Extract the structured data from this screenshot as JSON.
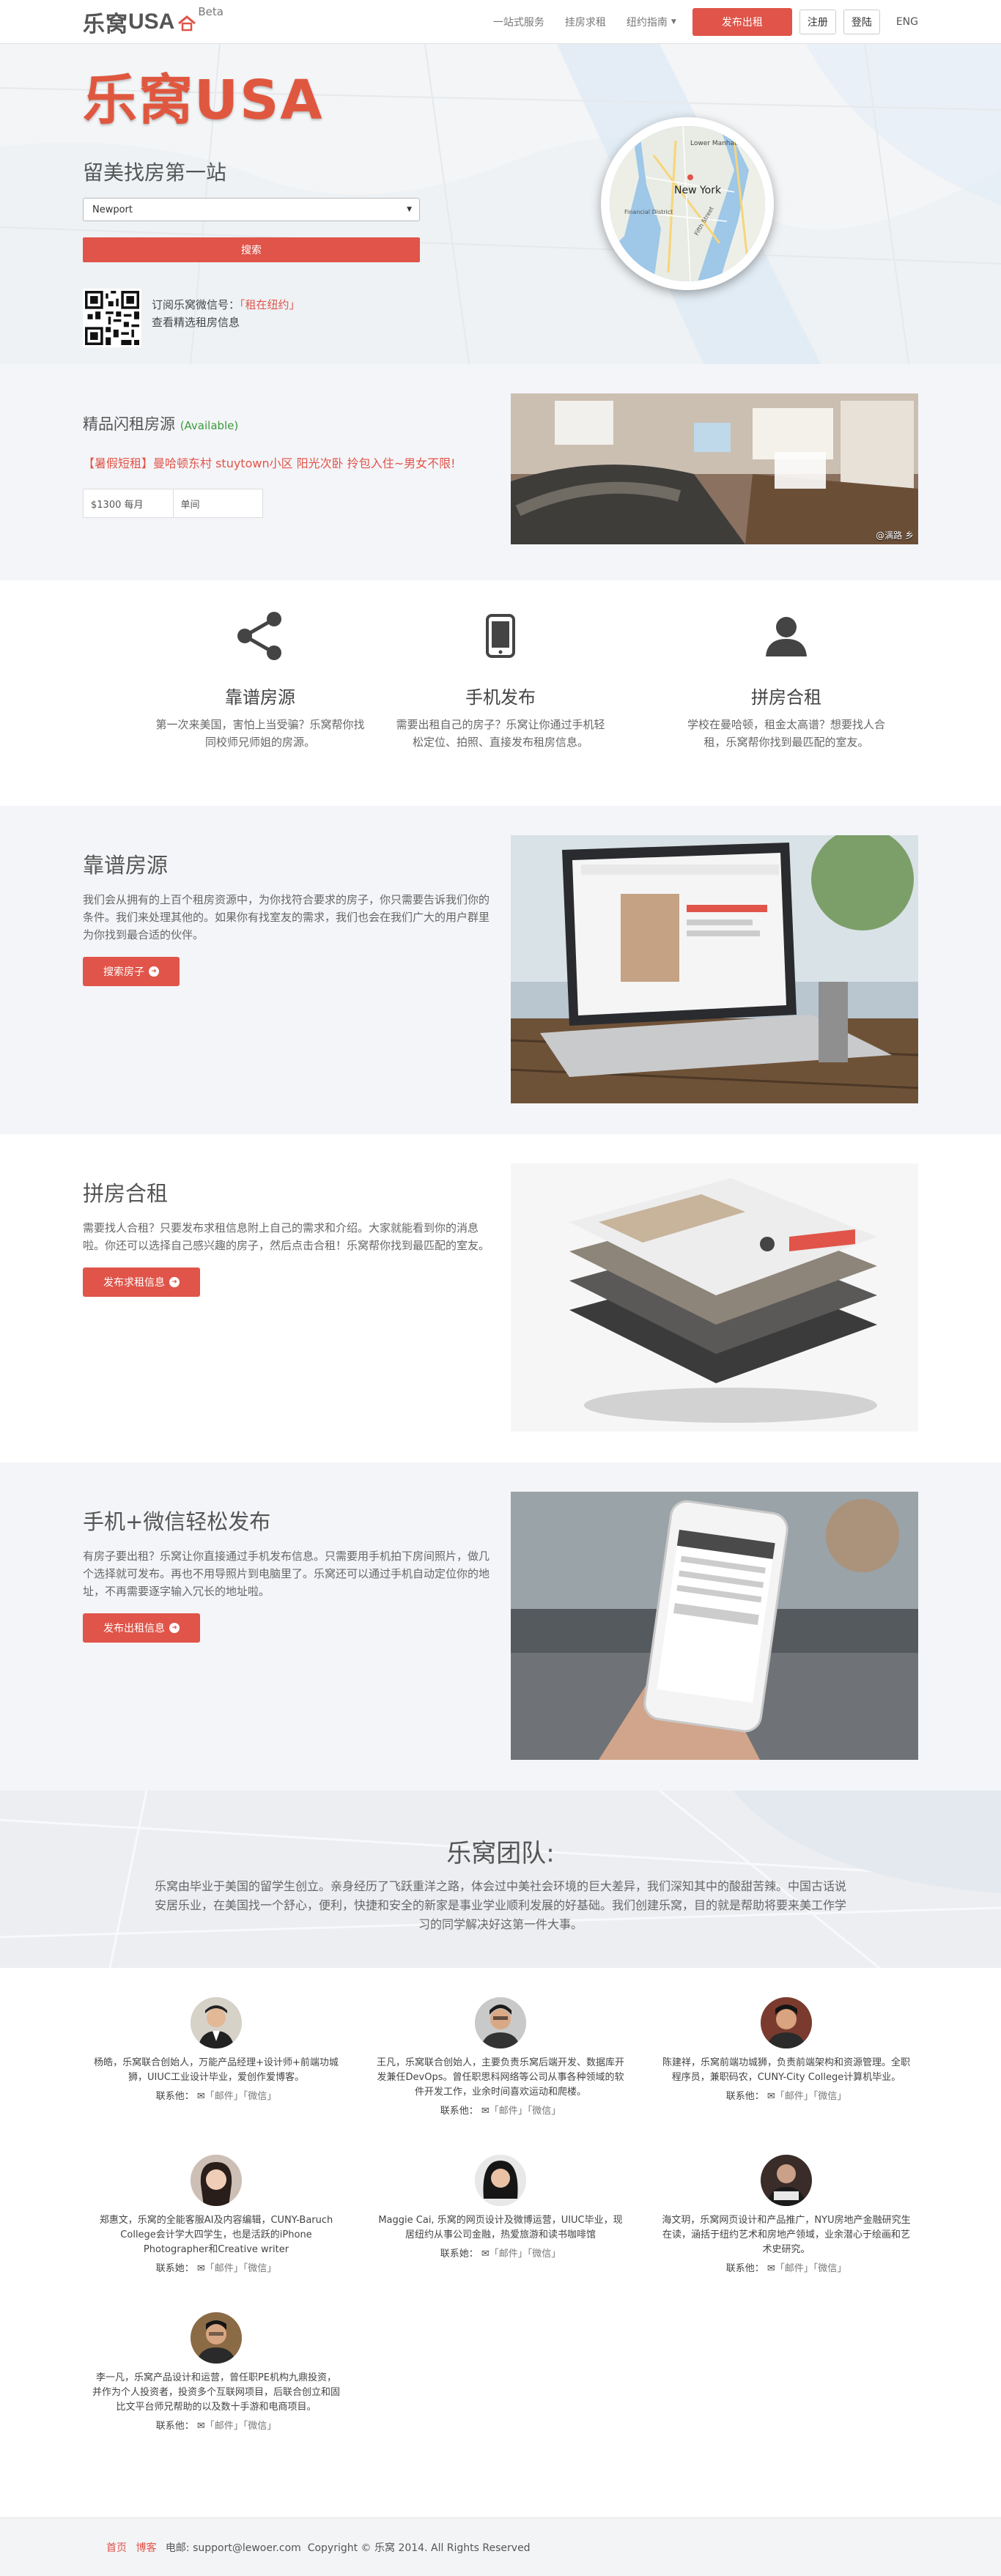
{
  "nav": {
    "logo_cn": "乐窝",
    "logo_en": "USA",
    "beta": "Beta",
    "links": [
      "一站式服务",
      "挂房求租",
      "纽约指南"
    ],
    "post_button": "发布出租",
    "register": "注册",
    "login": "登陆",
    "lang": "ENG"
  },
  "hero": {
    "title": "乐窝USA",
    "subtitle": "留美找房第一站",
    "select_value": "Newport",
    "search_button": "搜索",
    "wechat_text": "订阅乐窝微信号：",
    "wechat_id": "「租在纽约」",
    "wechat_sub": "查看精选租房信息",
    "map_labels": [
      "Lower Manhattan",
      "New York",
      "Financial District",
      "Fifth Street"
    ]
  },
  "listing": {
    "title": "精品闪租房源",
    "available": "(Available)",
    "desc": "【暑假短租】曼哈顿东村 stuytown小区 阳光次卧 拎包入住~男女不限!",
    "price": "$1300 每月",
    "room_type": "单间",
    "photo_credit": "@满路 乡"
  },
  "features": [
    {
      "icon": "share-icon",
      "title": "靠谱房源",
      "text": "第一次来美国，害怕上当受骗？乐窝帮你找同校师兄师姐的房源。"
    },
    {
      "icon": "mobile-icon",
      "title": "手机发布",
      "text": "需要出租自己的房子？乐窝让你通过手机轻松定位、拍照、直接发布租房信息。"
    },
    {
      "icon": "user-icon",
      "title": "拼房合租",
      "text": "学校在曼哈顿，租金太高谱？想要找人合租，乐窝帮你找到最匹配的室友。"
    }
  ],
  "sections": [
    {
      "title": "靠谱房源",
      "text": "我们会从拥有的上百个租房资源中，为你找符合要求的房子，你只需要告诉我们你的条件。我们来处理其他的。如果你有找室友的需求，我们也会在我们广大的用户群里为你找到最合适的伙伴。",
      "button": "搜索房子"
    },
    {
      "title": "拼房合租",
      "text": "需要找人合租？只要发布求租信息附上自己的需求和介绍。大家就能看到你的消息啦。你还可以选择自己感兴趣的房子，然后点击合租！乐窝帮你找到最匹配的室友。",
      "button": "发布求租信息"
    },
    {
      "title": "手机+微信轻松发布",
      "text": "有房子要出租？乐窝让你直接通过手机发布信息。只需要用手机拍下房间照片，做几个选择就可发布。再也不用导照片到电脑里了。乐窝还可以通过手机自动定位你的地址，不再需要逐字输入冗长的地址啦。",
      "button": "发布出租信息"
    }
  ],
  "team_head": {
    "title": "乐窝团队:",
    "desc": "乐窝由毕业于美国的留学生创立。亲身经历了飞跃重洋之路，体会过中美社会环境的巨大差异，我们深知其中的酸甜苦辣。中国古话说安居乐业，在美国找一个舒心，便利，快捷和安全的新家是事业学业顺利发展的好基础。我们创建乐窝，目的就是帮助将要来美工作学习的同学解决好这第一件大事。"
  },
  "team": [
    {
      "desc": "杨皓，乐窝联合创始人，万能产品经理+设计师+前端功城狮，UIUC工业设计毕业，爱创作爱博客。",
      "contact": "联系他：",
      "mail": "「邮件」",
      "wechat": "「微信」"
    },
    {
      "desc": "王凡，乐窝联合创始人，主要负责乐窝后端开发、数据库开发兼任DevOps。曾任职思科网络等公司从事各种领域的软件开发工作，业余时间喜欢运动和爬楼。",
      "contact": "联系他：",
      "mail": "「邮件」",
      "wechat": "「微信」"
    },
    {
      "desc": "陈建祥，乐窝前端功城狮，负责前端架构和资源管理。全职程序员，兼职码农，CUNY-City College计算机毕业。",
      "contact": "联系他：",
      "mail": "「邮件」",
      "wechat": "「微信」"
    },
    {
      "desc": "郑惠文，乐窝的全能客服AI及内容编辑，CUNY-Baruch College会计学大四学生，也是活跃的iPhone Photographer和Creative writer",
      "contact": "联系她：",
      "mail": "「邮件」",
      "wechat": "「微信」"
    },
    {
      "desc": "Maggie Cai, 乐窝的网页设计及微博运营，UIUC毕业，现居纽约从事公司金融，热爱旅游和读书咖啡馆",
      "contact": "联系她：",
      "mail": "「邮件」",
      "wechat": "「微信」"
    },
    {
      "desc": "海文玥，乐窝网页设计和产品推广，NYU房地产金融研究生在读，涵括于纽约艺术和房地产领域，业余潜心于绘画和艺术史研究。",
      "contact": "联系他：",
      "mail": "「邮件」",
      "wechat": "「微信」"
    },
    {
      "desc": "李一凡，乐窝产品设计和运营，曾任职PE机构九鼎投资，并作为个人投资者，投资多个互联网项目，后联合创立和固比文平台师兄帮助的以及数十手游和电商项目。",
      "contact": "联系他：",
      "mail": "「邮件」",
      "wechat": "「微信」"
    }
  ],
  "footer": {
    "home": "首页",
    "blog": "博客",
    "email_label": "电邮:",
    "email": "support@lewoer.com",
    "copyright": "Copyright © 乐窝 2014. All Rights Reserved"
  },
  "colors": {
    "accent": "#e05449",
    "green": "#3a9a3a"
  }
}
